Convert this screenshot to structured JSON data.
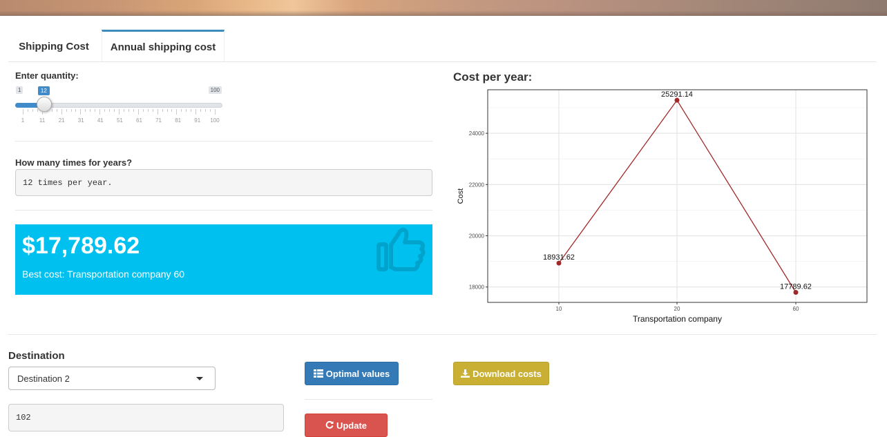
{
  "tabs": [
    {
      "label": "Shipping Cost",
      "active": false
    },
    {
      "label": "Annual shipping cost",
      "active": true
    }
  ],
  "quantity": {
    "label": "Enter quantity:",
    "min": 1,
    "max": 100,
    "value": 12,
    "min_label": "1",
    "max_label": "100",
    "value_label": "12",
    "grid_labels": [
      "1",
      "11",
      "21",
      "31",
      "41",
      "51",
      "61",
      "71",
      "81",
      "91",
      "100"
    ]
  },
  "frequency": {
    "label": "How many times for years?",
    "output": "12 times per year."
  },
  "value_box": {
    "value": "$17,789.62",
    "subtitle": "Best cost: Transportation company 60",
    "icon": "thumbs-up-icon",
    "color": "#00c0ef"
  },
  "chart_section": {
    "title": "Cost per year:"
  },
  "chart_data": {
    "type": "line",
    "title": "",
    "xlabel": "Transportation company",
    "ylabel": "Cost",
    "categories": [
      "10",
      "20",
      "60"
    ],
    "values": [
      18931.62,
      25291.14,
      17789.62
    ],
    "data_labels": [
      "18931.62",
      "25291.14",
      "17789.62"
    ],
    "yticks": [
      "18000",
      "20000",
      "22000",
      "24000"
    ],
    "ytick_values": [
      18000,
      20000,
      22000,
      24000
    ],
    "ylim": [
      17400,
      25700
    ],
    "grid": true,
    "color": "#a02828"
  },
  "destination": {
    "label": "Destination",
    "selected": "Destination 2",
    "number_output": "102"
  },
  "buttons": {
    "optimal": {
      "label": "Optimal values",
      "icon": "table-icon",
      "color": "#337ab7"
    },
    "download": {
      "label": "Download costs",
      "icon": "download-icon",
      "color": "#c9b035"
    },
    "update": {
      "label": "Update",
      "icon": "refresh-icon",
      "color": "#d9534f"
    }
  }
}
